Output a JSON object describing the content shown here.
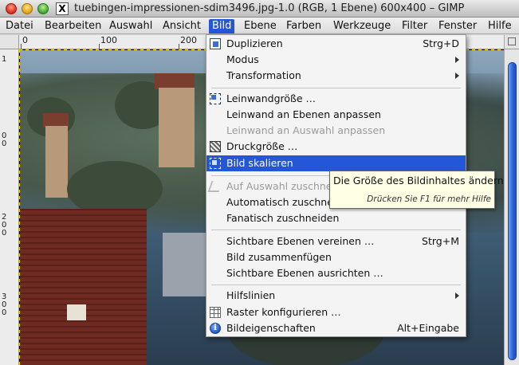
{
  "window": {
    "title": "tuebingen-impressionen-sdim3496.jpg-1.0 (RGB, 1 Ebene) 600x400 – GIMP",
    "x_badge": "X"
  },
  "menubar": {
    "items": [
      {
        "label": "Datei"
      },
      {
        "label": "Bearbeiten"
      },
      {
        "label": "Auswahl"
      },
      {
        "label": "Ansicht"
      },
      {
        "label": "Bild",
        "active": true
      },
      {
        "label": "Ebene"
      },
      {
        "label": "Farben"
      },
      {
        "label": "Werkzeuge"
      },
      {
        "label": "Filter"
      },
      {
        "label": "Fenster"
      },
      {
        "label": "Hilfe"
      }
    ]
  },
  "rulers": {
    "horizontal": [
      "0",
      "100",
      "200"
    ],
    "vertical": [
      [
        "1",
        "0",
        "0"
      ],
      [
        "2",
        "0",
        "0"
      ],
      [
        "3",
        "0",
        "0"
      ]
    ]
  },
  "bild_menu": {
    "items": [
      {
        "label": "Duplizieren",
        "accel": "Strg+D",
        "icon": "duplicate-icon"
      },
      {
        "label": "Modus",
        "submenu": true
      },
      {
        "label": "Transformation",
        "submenu": true
      },
      {
        "label": "Leinwandgröße …",
        "icon": "canvas-size-icon"
      },
      {
        "label": "Leinwand an Ebenen anpassen"
      },
      {
        "label": "Leinwand an Auswahl anpassen",
        "disabled": true
      },
      {
        "label": "Druckgröße …",
        "icon": "print-size-icon"
      },
      {
        "label": "Bild skalieren",
        "icon": "scale-image-icon",
        "selected": true
      },
      {
        "label": "Auf Auswahl zuschneiden",
        "icon": "crop-icon",
        "disabled": true
      },
      {
        "label": "Automatisch zuschneiden"
      },
      {
        "label": "Fanatisch zuschneiden"
      },
      {
        "label": "Sichtbare Ebenen vereinen …",
        "accel": "Strg+M"
      },
      {
        "label": "Bild zusammenfügen"
      },
      {
        "label": "Sichtbare Ebenen ausrichten …"
      },
      {
        "label": "Hilfslinien",
        "submenu": true
      },
      {
        "label": "Raster konfigurieren …",
        "icon": "grid-icon"
      },
      {
        "label": "Bildeigenschaften",
        "accel": "Alt+Eingabe",
        "icon": "info-icon"
      }
    ]
  },
  "tooltip": {
    "text": "Die Größe des Bildinhaltes ändern",
    "hint": "Drücken Sie F1 für mehr Hilfe"
  },
  "colors": {
    "accent": "#2456d8",
    "menu_bg": "#f4f4f4",
    "tooltip_bg": "#ffffe6"
  }
}
